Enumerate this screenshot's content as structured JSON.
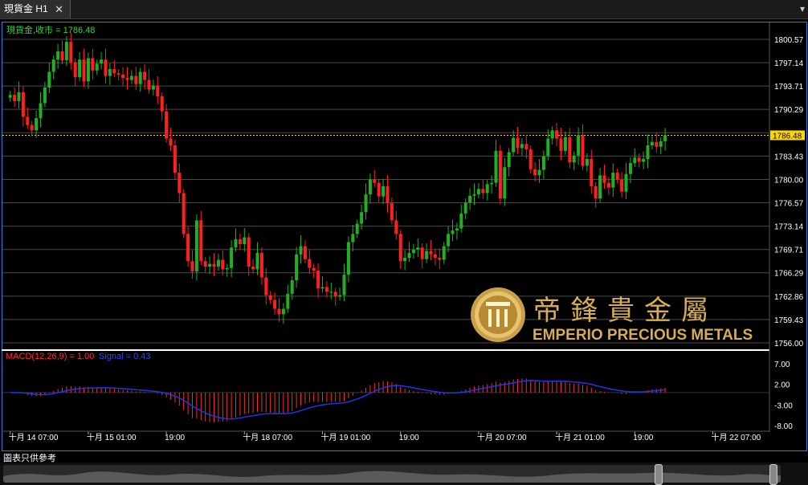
{
  "tab": {
    "title": "現貨金 H1",
    "close": "✕",
    "menu": "▾"
  },
  "legend": {
    "price": "現貨金,收市 = 1786.48",
    "macd_label": "MACD(12,26,9) = 1.00",
    "signal_label": "Signal = 0.43"
  },
  "logo": {
    "chinese": "帝鋒貴金屬",
    "english": "EMPERIO PRECIOUS METALS"
  },
  "footer": {
    "note": "圖表只供參考"
  },
  "colors": {
    "up": "#21b021",
    "down": "#ff1f1f",
    "grid": "#4a4a4a",
    "signal": "#2233ee",
    "macd": "#ff2a2a",
    "last": "#ffd700"
  },
  "chart_data": [
    {
      "type": "candlestick",
      "title": "現貨金 H1",
      "last_price": "1786.48",
      "y_ticks": [
        "1800.57",
        "1797.14",
        "1793.71",
        "1790.29",
        "1786.86",
        "1783.43",
        "1780.00",
        "1776.57",
        "1773.14",
        "1769.71",
        "1766.29",
        "1762.86",
        "1759.43",
        "1756.00"
      ],
      "ylim": [
        1756.0,
        1800.57
      ],
      "x_ticks": [
        "十月 14 07:00",
        "十月 15 01:00",
        "19:00",
        "十月 18 07:00",
        "十月 19 01:00",
        "19:00",
        "十月 20 07:00",
        "十月 21 01:00",
        "19:00",
        "十月 22 07:00"
      ],
      "x_tick_bars": [
        0,
        18,
        36,
        54,
        72,
        90,
        108,
        126,
        144,
        162
      ],
      "closes": [
        1792.4,
        1791.5,
        1792.8,
        1789.2,
        1788.0,
        1787.2,
        1789.0,
        1791.2,
        1793.5,
        1795.8,
        1797.6,
        1798.8,
        1797.5,
        1800.2,
        1797.2,
        1795.0,
        1797.6,
        1794.4,
        1797.8,
        1796.0,
        1797.0,
        1797.6,
        1795.2,
        1796.2,
        1795.6,
        1795.4,
        1794.9,
        1794.6,
        1795.2,
        1794.0,
        1795.8,
        1794.6,
        1793.2,
        1793.8,
        1792.2,
        1790.0,
        1786.0,
        1785.0,
        1781.0,
        1778.0,
        1772.0,
        1768.0,
        1766.5,
        1774.0,
        1768.0,
        1767.2,
        1767.6,
        1767.2,
        1768.2,
        1766.8,
        1767.0,
        1770.0,
        1771.2,
        1770.5,
        1771.5,
        1767.2,
        1766.8,
        1769.2,
        1765.6,
        1763.0,
        1762.3,
        1761.0,
        1760.2,
        1761.0,
        1763.2,
        1765.2,
        1769.0,
        1770.2,
        1768.3,
        1767.0,
        1766.6,
        1764.0,
        1764.2,
        1763.5,
        1763.5,
        1762.8,
        1763.0,
        1766.0,
        1770.8,
        1772.0,
        1773.5,
        1775.2,
        1777.8,
        1780.0,
        1779.5,
        1777.5,
        1779.0,
        1776.5,
        1774.0,
        1772.0,
        1768.0,
        1768.5,
        1769.2,
        1769.7,
        1770.0,
        1768.3,
        1769.5,
        1769.0,
        1768.5,
        1768.2,
        1770.2,
        1772.0,
        1772.5,
        1772.8,
        1775.0,
        1776.6,
        1777.6,
        1777.8,
        1778.6,
        1778.0,
        1779.3,
        1779.5,
        1784.2,
        1777.2,
        1781.8,
        1784.0,
        1786.1,
        1784.6,
        1785.2,
        1784.4,
        1781.5,
        1780.6,
        1781.4,
        1783.4,
        1786.0,
        1787.2,
        1786.0,
        1784.2,
        1786.2,
        1782.5,
        1783.5,
        1786.5,
        1782.0,
        1783.0,
        1779.0,
        1777.2,
        1780.6,
        1779.5,
        1778.8,
        1781.0,
        1780.0,
        1778.2,
        1780.8,
        1782.4,
        1783.2,
        1782.6,
        1783.0,
        1785.0,
        1785.5,
        1784.8,
        1785.6,
        1786.48
      ],
      "macd_ylim": [
        -8.0,
        7.0
      ],
      "macd_ticks": [
        "7.00",
        "2.00",
        "-3.00",
        "-8.00"
      ],
      "macd_series": [
        {
          "name": "MACD(12,26,9)",
          "value": "1.00"
        },
        {
          "name": "Signal",
          "value": "0.43"
        }
      ]
    }
  ]
}
